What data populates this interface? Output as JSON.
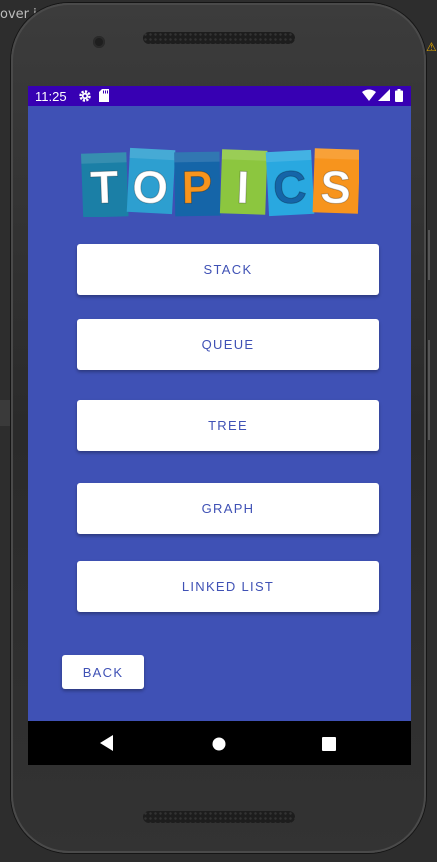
{
  "ide": {
    "partial_text": "over i",
    "warning_glyph": "⚠"
  },
  "status_bar": {
    "time": "11:25",
    "icons": [
      "settings-gear-icon",
      "sd-card-icon",
      "wifi-icon",
      "signal-icon",
      "battery-icon"
    ],
    "color": "#3700b3"
  },
  "logo": {
    "letters": [
      "T",
      "O",
      "P",
      "I",
      "C",
      "S"
    ],
    "tile_colors": [
      "#1b7fa6",
      "#2d9fd0",
      "#1565a8",
      "#8cc63f",
      "#29a8e0",
      "#f7941d"
    ]
  },
  "topics": {
    "items": [
      {
        "label": "STACK"
      },
      {
        "label": "QUEUE"
      },
      {
        "label": "TREE"
      },
      {
        "label": "GRAPH"
      },
      {
        "label": "LINKED LIST"
      }
    ]
  },
  "back_button": {
    "label": "BACK"
  },
  "nav_bar": {
    "buttons": [
      "back-triangle-icon",
      "home-circle-icon",
      "recents-square-icon"
    ]
  },
  "theme": {
    "background": "#3f51b5",
    "button_bg": "#ffffff",
    "button_text": "#3f51b5"
  }
}
